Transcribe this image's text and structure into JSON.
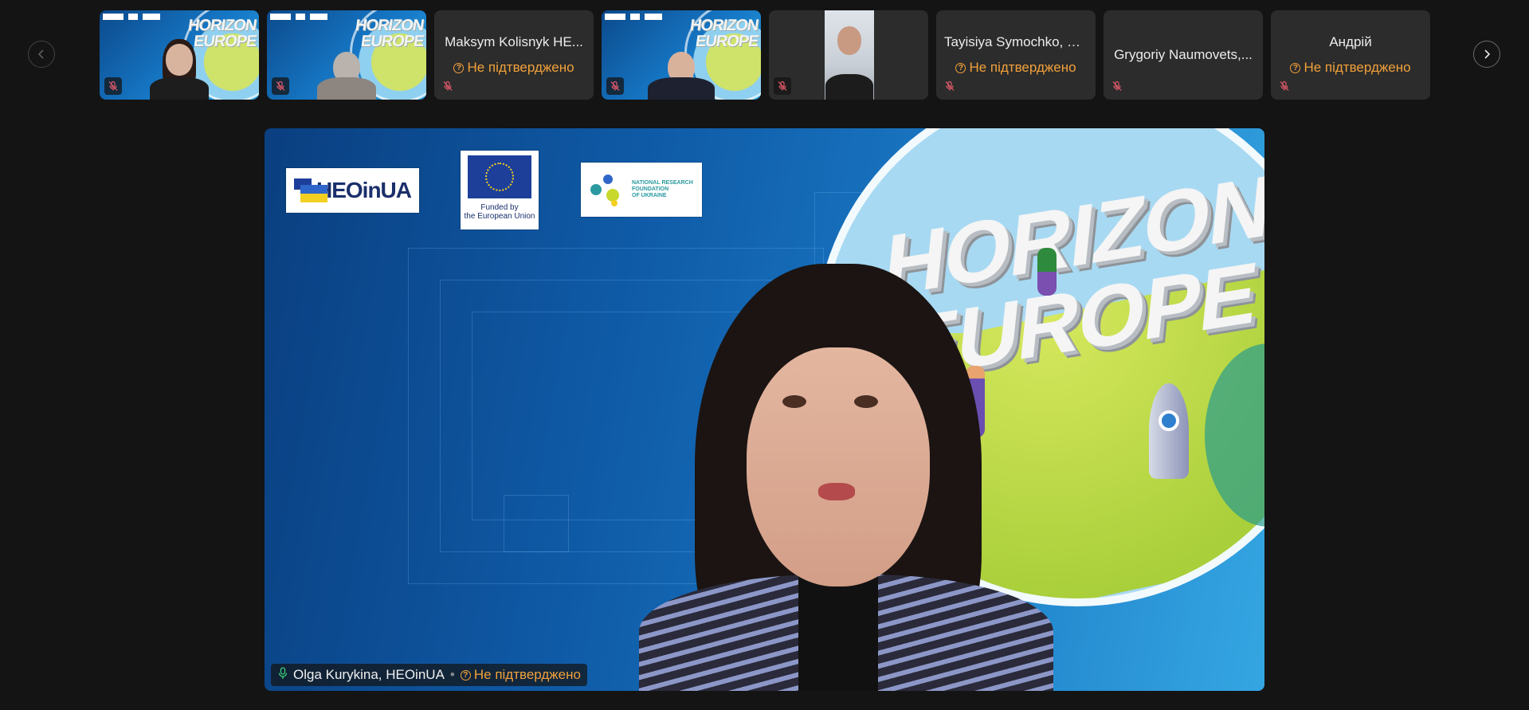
{
  "nav": {
    "prev_icon": "chevron-left-icon",
    "next_icon": "chevron-right-icon"
  },
  "participants": [
    {
      "id": "p1",
      "name": "",
      "kind": "video",
      "muted": true
    },
    {
      "id": "p2",
      "name": "",
      "kind": "video",
      "muted": true
    },
    {
      "id": "p3",
      "name": "Maksym Kolisnyk HE...",
      "status": "Не підтверджено",
      "kind": "avatar",
      "muted": true
    },
    {
      "id": "p4",
      "name": "",
      "kind": "video",
      "muted": true
    },
    {
      "id": "p5",
      "name": "",
      "kind": "photo",
      "muted": true
    },
    {
      "id": "p6",
      "name": "Tayisiya Symochko, H...",
      "status": "Не підтверджено",
      "kind": "avatar",
      "muted": true
    },
    {
      "id": "p7",
      "name": "Grygoriy Naumovets,...",
      "kind": "avatar",
      "muted": true
    },
    {
      "id": "p8",
      "name": "Андрій",
      "status": "Не підтверджено",
      "kind": "avatar",
      "muted": true
    }
  ],
  "main": {
    "speaker_name": "Olga Kurykina, HEOinUA",
    "separator": "•",
    "status": "Не підтверджено",
    "background": {
      "horizon_line1": "HORIZON",
      "horizon_line2": "EUROPE",
      "logo_heo_text": "HEOinUA",
      "logo_eu_caption_1": "Funded by",
      "logo_eu_caption_2": "the European Union",
      "logo_nrf_line1": "NATIONAL RESEARCH",
      "logo_nrf_line2": "FOUNDATION",
      "logo_nrf_line3": "OF UKRAINE"
    }
  },
  "tile_mini": {
    "horizon_line1": "HORIZON",
    "horizon_line2": "EUROPE",
    "horizon_line2_short": "EUROPE"
  },
  "colors": {
    "background": "#141414",
    "tile": "#2c2c2c",
    "pending": "#f2a13a",
    "stage_blue": "#0f5aa6"
  }
}
